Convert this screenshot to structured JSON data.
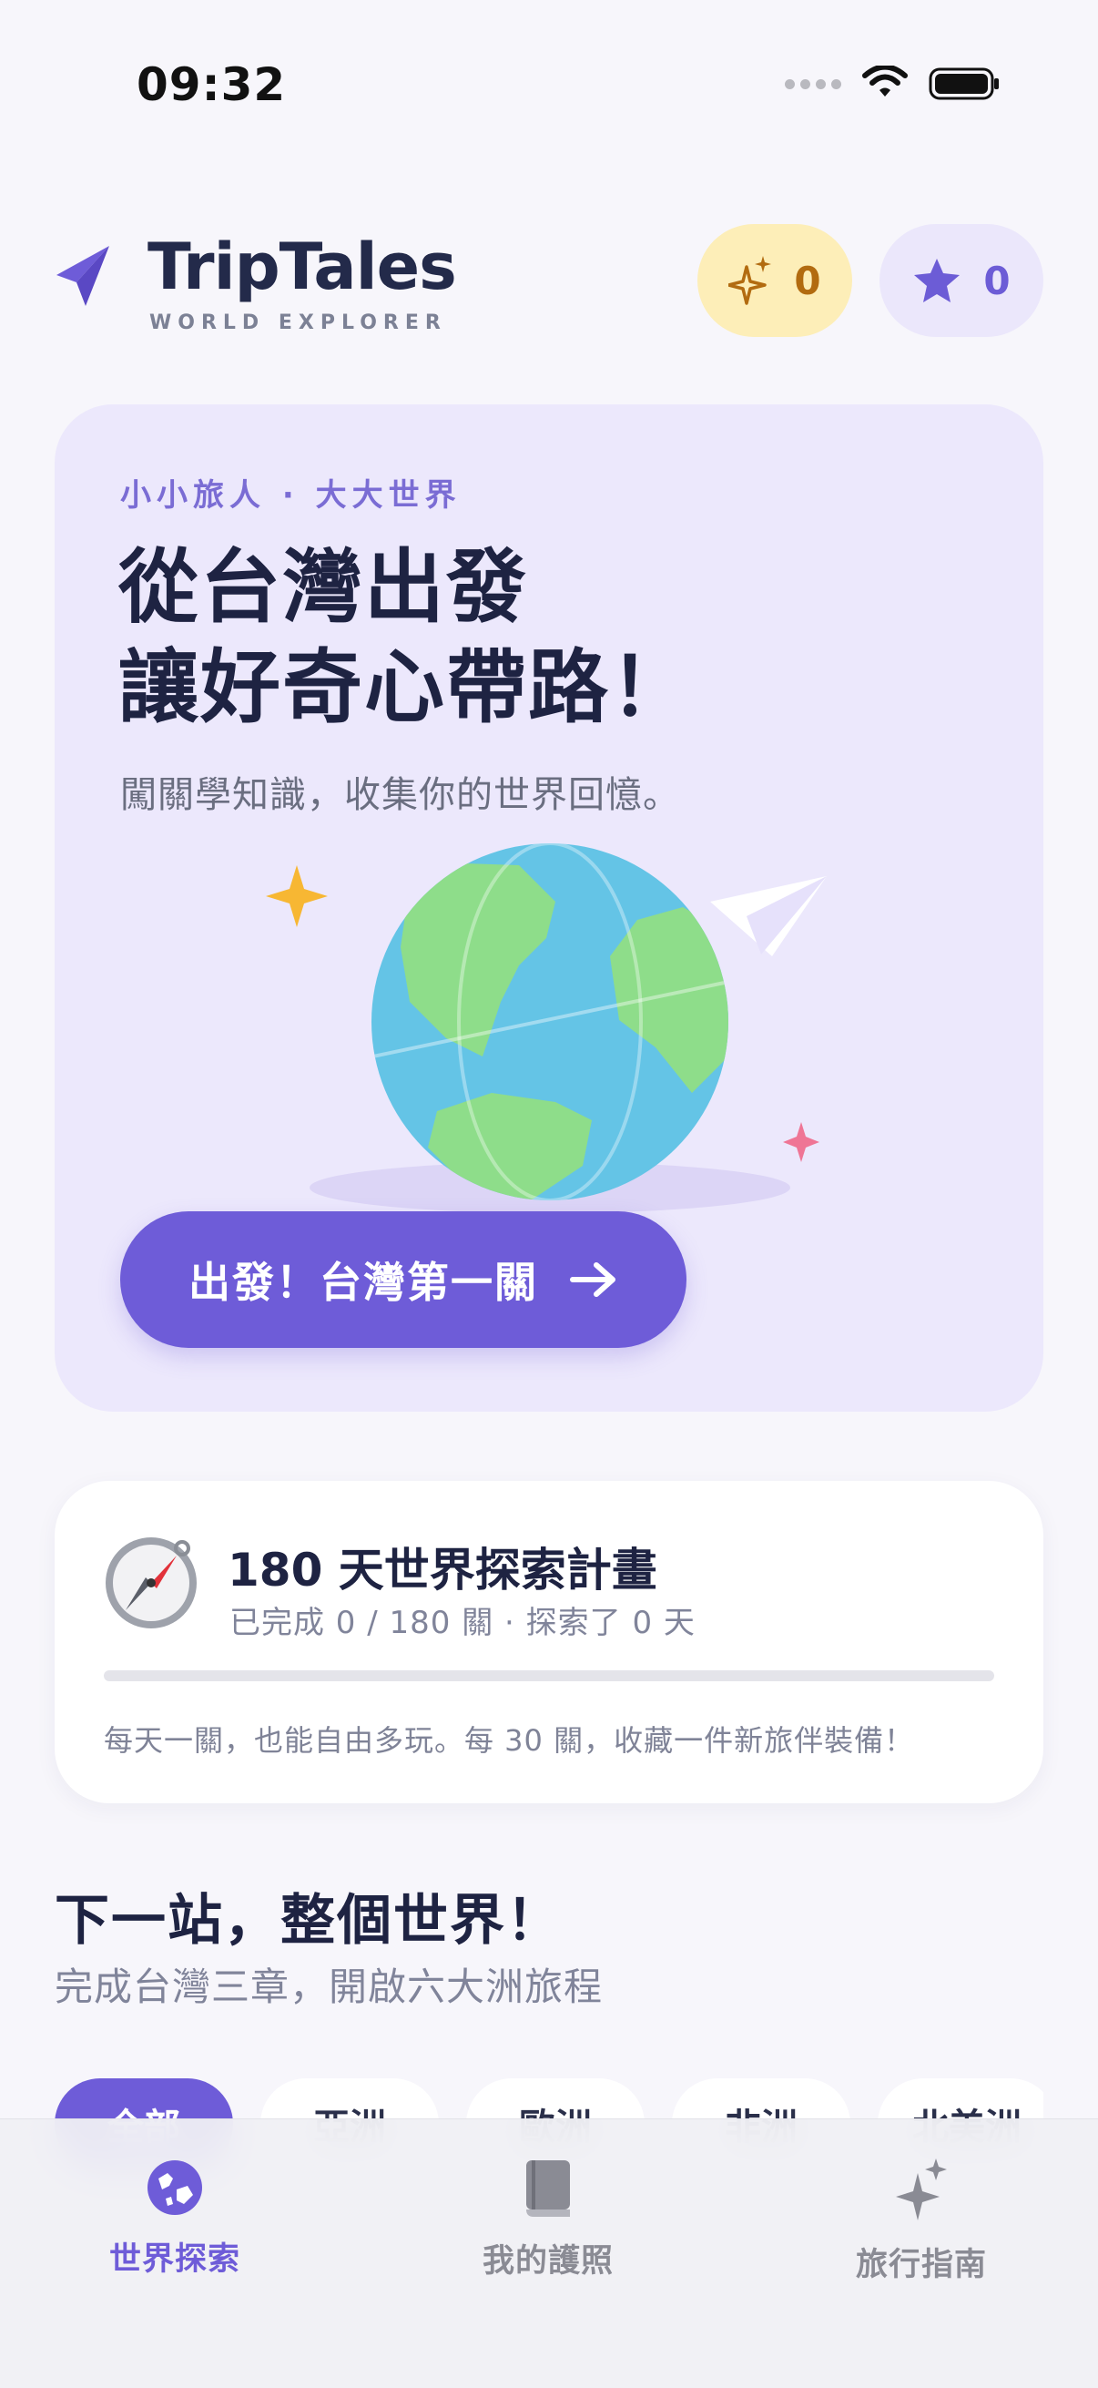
{
  "status_bar": {
    "time": "09:32"
  },
  "header": {
    "brand_title": "TripTales",
    "brand_subtitle": "WORLD EXPLORER",
    "sparkle_count": "0",
    "star_count": "0"
  },
  "hero": {
    "kicker": "小小旅人 · 大大世界",
    "title_line1": "從台灣出發",
    "title_line2": "讓好奇心帶路！",
    "description": "闖關學知識，收集你的世界回憶。",
    "cta_label": "出發！台灣第一關"
  },
  "plan": {
    "title": "180 天世界探索計畫",
    "subtitle": "已完成 0 / 180 關 · 探索了 0 天",
    "progress": 0,
    "note": "每天一關，也能自由多玩。每 30 關，收藏一件新旅伴裝備！"
  },
  "next": {
    "title": "下一站，整個世界！",
    "subtitle": "完成台灣三章，開啟六大洲旅程",
    "chips": [
      "全部",
      "亞洲",
      "歐洲",
      "非洲",
      "北美洲"
    ]
  },
  "tabs": [
    {
      "label": "世界探索",
      "icon": "globe-icon"
    },
    {
      "label": "我的護照",
      "icon": "book-icon"
    },
    {
      "label": "旅行指南",
      "icon": "sparkles-icon"
    }
  ],
  "colors": {
    "accent": "#6e5cd8",
    "hero_bg": "#ece8fc",
    "sparkle_pill_bg": "#fdeeb8",
    "star_pill_bg": "#ebe7fb"
  }
}
